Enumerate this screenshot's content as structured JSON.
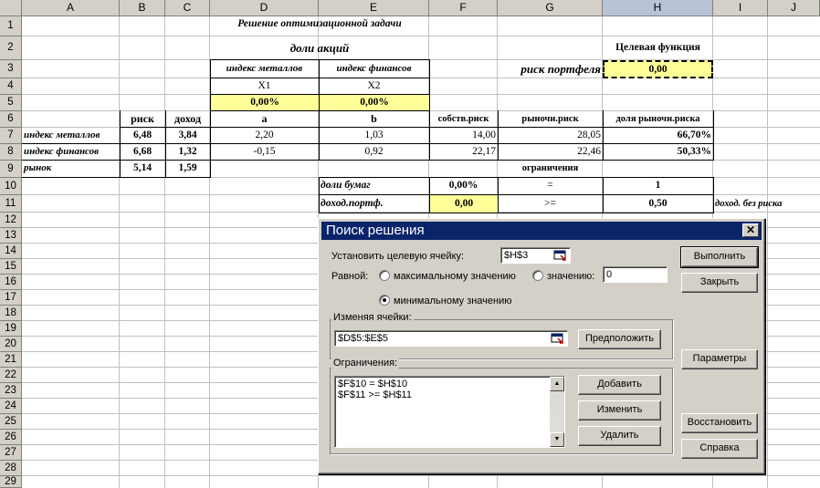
{
  "columns": [
    "A",
    "B",
    "C",
    "D",
    "E",
    "F",
    "G",
    "H",
    "I",
    "J"
  ],
  "rows": [
    "1",
    "2",
    "3",
    "4",
    "5",
    "6",
    "7",
    "8",
    "9",
    "10",
    "11",
    "12",
    "13",
    "14",
    "15",
    "16",
    "17",
    "18",
    "19",
    "20",
    "21",
    "22",
    "23",
    "24",
    "25",
    "26",
    "27",
    "28",
    "29"
  ],
  "cells": {
    "title": "Решение  оптимизационной задачи",
    "shares_header": "доли акций",
    "target_header": "Целевая функция",
    "metals_index_col": "индекс металлов",
    "finance_index_col": "индекс финансов",
    "portfolio_risk_label": "риск портфеля",
    "portfolio_risk_value": "0,00",
    "x1": "X1",
    "x2": "X2",
    "x1_value": "0,00%",
    "x2_value": "0,00%",
    "hdr_risk": "риск",
    "hdr_income": "доход",
    "hdr_a": "a",
    "hdr_b": "b",
    "hdr_own_risk": "собств.риск",
    "hdr_market_risk": "рыночн.риск",
    "hdr_market_share": "доля рыночн.риска",
    "row7_name": "индекс металлов",
    "row7_risk": "6,48",
    "row7_income": "3,84",
    "row7_a": "2,20",
    "row7_b": "1,03",
    "row7_own": "14,00",
    "row7_market": "28,05",
    "row7_share": "66,70%",
    "row8_name": "индекс финансов",
    "row8_risk": "6,68",
    "row8_income": "1,32",
    "row8_a": "-0,15",
    "row8_b": "0,92",
    "row8_own": "22,17",
    "row8_market": "22,46",
    "row8_share": "50,33%",
    "row9_name": "рынок",
    "row9_risk": "5,14",
    "row9_income": "1,59",
    "constraints_header": "ограничения",
    "row10_label": "доли бумаг",
    "row10_value": "0,00%",
    "row10_op": "=",
    "row10_limit": "1",
    "row11_label": "доход.портф.",
    "row11_value": "0,00",
    "row11_op": ">=",
    "row11_limit": "0,50",
    "row11_note": "доход. без риска"
  },
  "dialog": {
    "title": "Поиск решения",
    "target_cell_label": "Установить целевую ячейку:",
    "target_cell_value": "$H$3",
    "equal_label": "Равной:",
    "radio_max": "максимальному значению",
    "radio_value": "значению:",
    "value_field": "0",
    "radio_min": "минимальному значению",
    "selected_radio": "min",
    "changing_cells_label": "Изменяя ячейки:",
    "changing_cells_value": "$D$5:$E$5",
    "guess_button": "Предположить",
    "constraints_label": "Ограничения:",
    "constraints": [
      "$F$10 = $H$10",
      "$F$11 >= $H$11"
    ],
    "add_button": "Добавить",
    "change_button": "Изменить",
    "delete_button": "Удалить",
    "run_button": "Выполнить",
    "close_button": "Закрыть",
    "params_button": "Параметры",
    "restore_button": "Восстановить",
    "help_button": "Справка"
  }
}
